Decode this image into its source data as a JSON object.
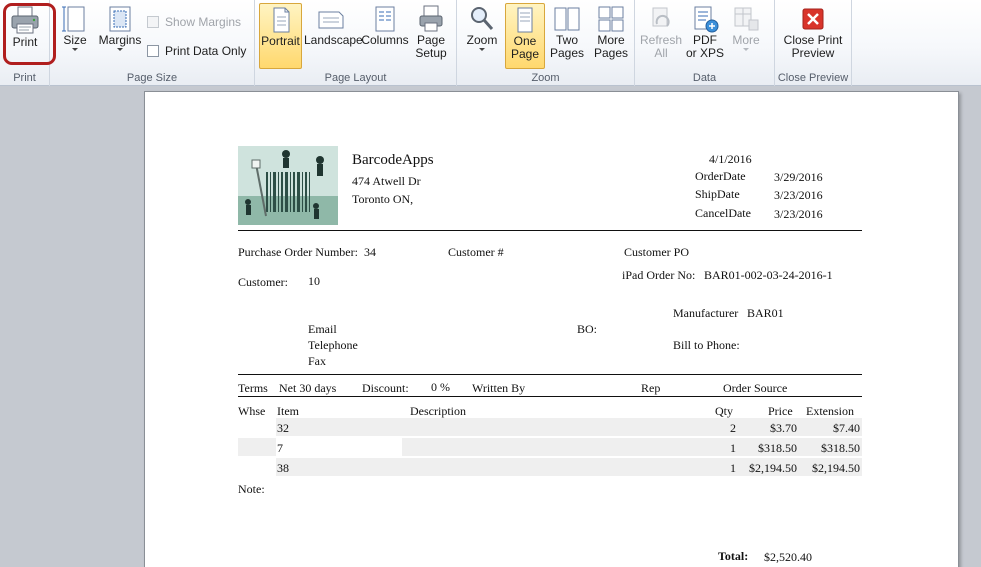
{
  "ribbon": {
    "groups": [
      {
        "id": "print",
        "label": "Print"
      },
      {
        "id": "page_size",
        "label": "Page Size"
      },
      {
        "id": "page_layout",
        "label": "Page Layout"
      },
      {
        "id": "zoom",
        "label": "Zoom"
      },
      {
        "id": "data",
        "label": "Data"
      },
      {
        "id": "close_preview",
        "label": "Close Preview"
      }
    ],
    "print": {
      "label": "Print",
      "icon": "printer-icon"
    },
    "size": {
      "label": "Size",
      "icon": "page-size-icon"
    },
    "margins": {
      "label": "Margins",
      "icon": "margins-icon"
    },
    "show_margins": {
      "label": "Show Margins",
      "checked": false,
      "enabled": false
    },
    "print_data_only": {
      "label": "Print Data Only",
      "checked": false,
      "enabled": true
    },
    "portrait": {
      "label": "Portrait",
      "selected": true,
      "icon": "portrait-icon"
    },
    "landscape": {
      "label": "Landscape",
      "icon": "landscape-icon"
    },
    "columns": {
      "label": "Columns",
      "icon": "columns-icon"
    },
    "page_setup": {
      "label_1": "Page",
      "label_2": "Setup",
      "icon": "page-setup-icon"
    },
    "zoom": {
      "label": "Zoom",
      "icon": "magnifier-icon"
    },
    "one_page": {
      "label_1": "One",
      "label_2": "Page",
      "selected": true,
      "icon": "one-page-icon"
    },
    "two_pages": {
      "label_1": "Two",
      "label_2": "Pages",
      "icon": "two-pages-icon"
    },
    "more_pages": {
      "label_1": "More",
      "label_2": "Pages",
      "icon": "more-pages-icon"
    },
    "refresh_all": {
      "label_1": "Refresh",
      "label_2": "All",
      "enabled": false,
      "icon": "refresh-icon"
    },
    "pdf_xps": {
      "label_1": "PDF",
      "label_2": "or XPS",
      "icon": "pdf-xps-icon"
    },
    "more": {
      "label": "More",
      "enabled": false,
      "icon": "more-export-icon"
    },
    "close_print_preview": {
      "label_1": "Close Print",
      "label_2": "Preview",
      "icon": "close-icon"
    }
  },
  "report": {
    "company": {
      "name": "BarcodeApps",
      "address": "474 Atwell Dr",
      "city": "Toronto ON,"
    },
    "logo_icon": "barcode-workers-logo",
    "date": "4/1/2016",
    "order_date": {
      "label": "OrderDate",
      "value": "3/29/2016"
    },
    "ship_date": {
      "label": "ShipDate",
      "value": "3/23/2016"
    },
    "cancel_date": {
      "label": "CancelDate",
      "value": "3/23/2016"
    },
    "po_number": {
      "label": "Purchase Order Number:",
      "value": "34"
    },
    "customer_num_label": "Customer #",
    "customer_po_label": "Customer PO",
    "ipad_order": {
      "label": "iPad Order No:",
      "value": "BAR01-002-03-24-2016-1"
    },
    "customer": {
      "label": "Customer:",
      "value": "10"
    },
    "manufacturer": {
      "label": "Manufacturer",
      "value": "BAR01"
    },
    "email_label": "Email",
    "telephone_label": "Telephone",
    "fax_label": "Fax",
    "bo_label": "BO:",
    "bill_to_phone_label": "Bill to Phone:",
    "terms": {
      "label": "Terms",
      "value": "Net 30 days"
    },
    "discount": {
      "label": "Discount:",
      "value": "0 %"
    },
    "written_by_label": "Written By",
    "rep_label": "Rep",
    "order_source_label": "Order Source",
    "columns": {
      "whse": "Whse",
      "item": "Item",
      "description": "Description",
      "qty": "Qty",
      "price": "Price",
      "extension": "Extension"
    },
    "lines": [
      {
        "whse": "",
        "item": "32",
        "description": "",
        "qty": "2",
        "price": "$3.70",
        "extension": "$7.40"
      },
      {
        "whse": "",
        "item": "7",
        "description": "",
        "qty": "1",
        "price": "$318.50",
        "extension": "$318.50"
      },
      {
        "whse": "",
        "item": "38",
        "description": "",
        "qty": "1",
        "price": "$2,194.50",
        "extension": "$2,194.50"
      }
    ],
    "note_label": "Note:",
    "total": {
      "label": "Total:",
      "value": "$2,520.40"
    }
  }
}
